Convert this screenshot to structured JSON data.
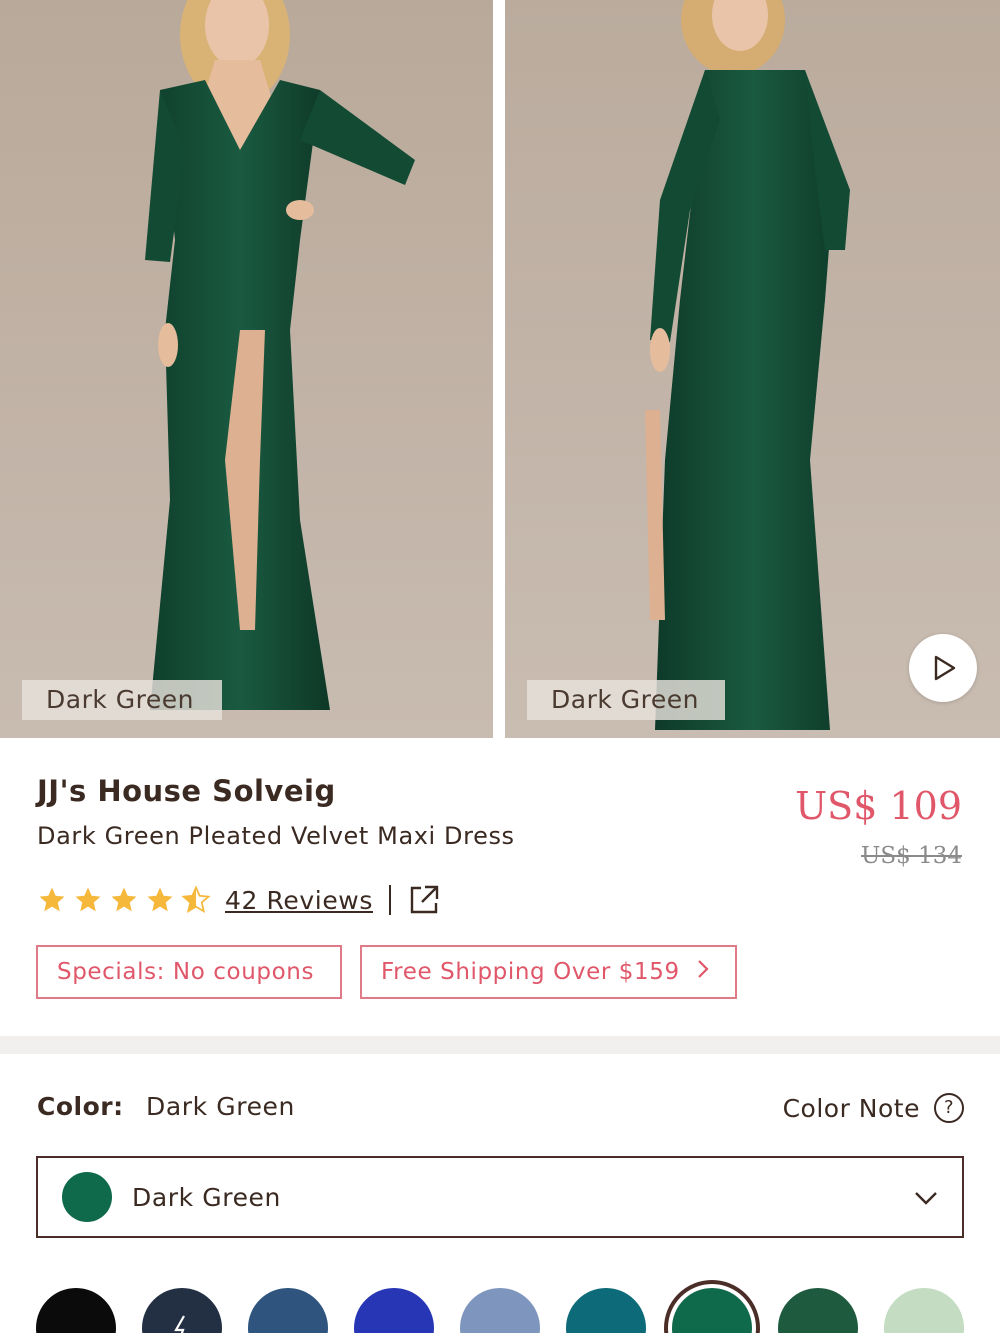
{
  "gallery": {
    "image_label_left": "Dark Green",
    "image_label_right": "Dark Green",
    "video_button_icon": "play-icon"
  },
  "product": {
    "brand": "JJ's House Solveig",
    "name": "Dark Green Pleated Velvet Maxi Dress",
    "price": "US$ 109",
    "original_price": "US$ 134",
    "rating": 4.5,
    "reviews_label": "42 Reviews",
    "share_icon": "external-link-icon"
  },
  "promos": {
    "specials": "Specials: No coupons",
    "shipping": "Free Shipping Over $159"
  },
  "color": {
    "label": "Color:",
    "selected": "Dark Green",
    "note_label": "Color Note",
    "dropdown_value": "Dark Green",
    "dropdown_color": "#0f6a4c",
    "swatches": [
      {
        "color": "#0b0b0b"
      },
      {
        "color": "#233044",
        "icon": "lightning-icon"
      },
      {
        "color": "#2f557f"
      },
      {
        "color": "#2636b5"
      },
      {
        "color": "#7e96be"
      },
      {
        "color": "#0d6a78"
      },
      {
        "color": "#0f6a4c",
        "selected": true
      },
      {
        "color": "#1e5a3e"
      },
      {
        "color": "#c3dcc2"
      }
    ]
  },
  "colors": {
    "accent": "#e0576a",
    "text": "#3b2a22",
    "star": "#f5b83b"
  }
}
